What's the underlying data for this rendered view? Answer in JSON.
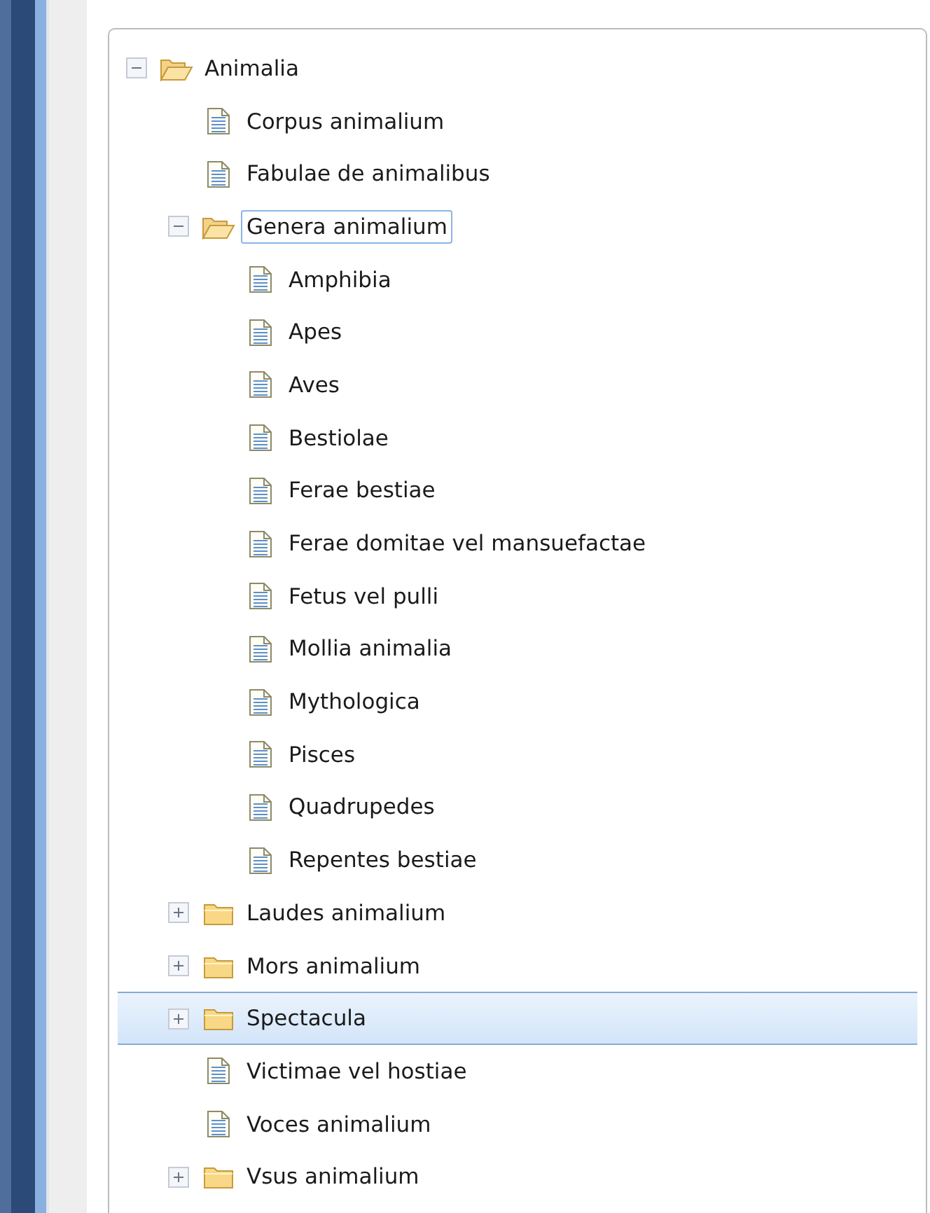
{
  "tree": [
    {
      "label": "Animalia",
      "kind": "folder",
      "expanded": true,
      "selected": false,
      "focused": false,
      "children": [
        {
          "label": "Corpus animalium",
          "kind": "document",
          "selected": false,
          "focused": false
        },
        {
          "label": "Fabulae de animalibus",
          "kind": "document",
          "selected": false,
          "focused": false
        },
        {
          "label": "Genera animalium",
          "kind": "folder",
          "expanded": true,
          "selected": false,
          "focused": true,
          "children": [
            {
              "label": "Amphibia",
              "kind": "document",
              "selected": false,
              "focused": false
            },
            {
              "label": "Apes",
              "kind": "document",
              "selected": false,
              "focused": false
            },
            {
              "label": "Aves",
              "kind": "document",
              "selected": false,
              "focused": false
            },
            {
              "label": "Bestiolae",
              "kind": "document",
              "selected": false,
              "focused": false
            },
            {
              "label": "Ferae bestiae",
              "kind": "document",
              "selected": false,
              "focused": false
            },
            {
              "label": "Ferae domitae vel mansuefactae",
              "kind": "document",
              "selected": false,
              "focused": false
            },
            {
              "label": "Fetus vel pulli",
              "kind": "document",
              "selected": false,
              "focused": false
            },
            {
              "label": "Mollia animalia",
              "kind": "document",
              "selected": false,
              "focused": false
            },
            {
              "label": "Mythologica",
              "kind": "document",
              "selected": false,
              "focused": false
            },
            {
              "label": "Pisces",
              "kind": "document",
              "selected": false,
              "focused": false
            },
            {
              "label": "Quadrupedes",
              "kind": "document",
              "selected": false,
              "focused": false
            },
            {
              "label": "Repentes bestiae",
              "kind": "document",
              "selected": false,
              "focused": false
            }
          ]
        },
        {
          "label": "Laudes animalium",
          "kind": "folder",
          "expanded": false,
          "selected": false,
          "focused": false
        },
        {
          "label": "Mors animalium",
          "kind": "folder",
          "expanded": false,
          "selected": false,
          "focused": false
        },
        {
          "label": "Spectacula",
          "kind": "folder",
          "expanded": false,
          "selected": true,
          "focused": false
        },
        {
          "label": "Victimae vel hostiae",
          "kind": "document",
          "selected": false,
          "focused": false
        },
        {
          "label": "Voces animalium",
          "kind": "document",
          "selected": false,
          "focused": false
        },
        {
          "label": "Vsus animalium",
          "kind": "folder",
          "expanded": false,
          "selected": false,
          "focused": false
        }
      ]
    }
  ]
}
